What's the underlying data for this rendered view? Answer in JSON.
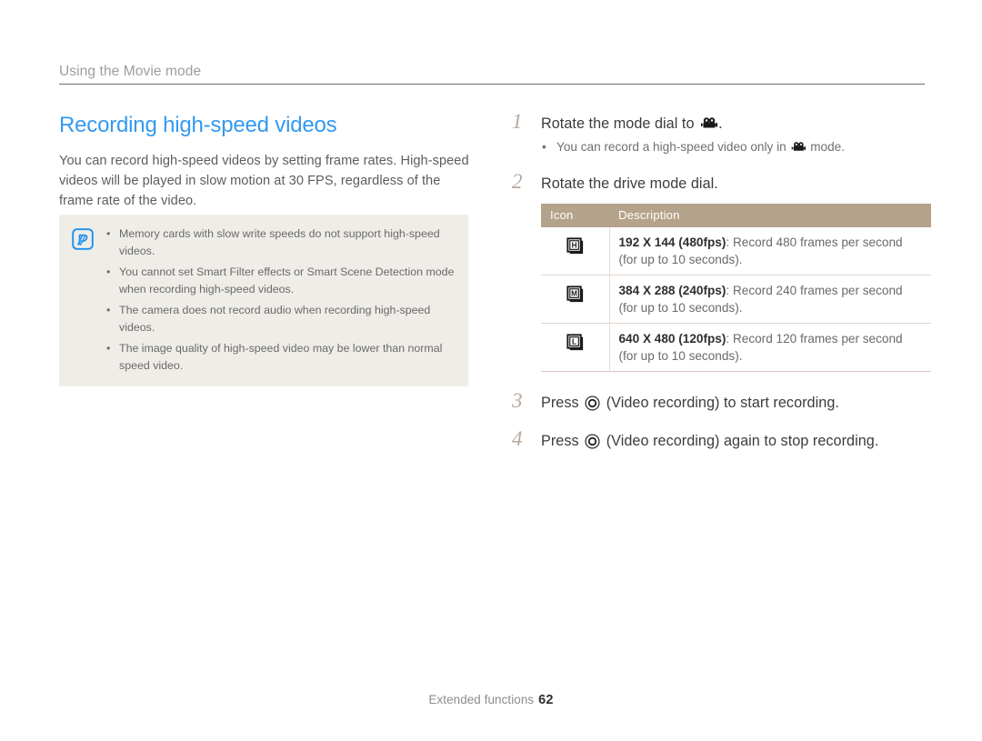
{
  "running_head": "Using the Movie mode",
  "left_column": {
    "title": "Recording high-speed videos",
    "intro": "You can record high-speed videos by setting frame rates. High-speed videos will be played in slow motion at 30 FPS, regardless of the frame rate of the video.",
    "note": {
      "icon": "note-pen-icon",
      "bullets": [
        "Memory cards with slow write speeds do not support high-speed videos.",
        "You cannot set Smart Filter effects or Smart Scene Detection mode when recording high-speed videos.",
        "The camera does not record audio when recording high-speed videos.",
        "The image quality of high-speed video may be lower than normal speed video."
      ],
      "bullet_glyph": "•"
    }
  },
  "right_column": {
    "steps": [
      {
        "number": "1",
        "text_before": "Rotate the mode dial to ",
        "icon": "movie-camera-icon",
        "text_after": ".",
        "sub": {
          "bullet_glyph": "•",
          "text_before": "You can record a high-speed video only in ",
          "icon": "movie-camera-icon",
          "text_after": " mode."
        }
      },
      {
        "number": "2",
        "text_before": "Rotate the drive mode dial.",
        "icon": "",
        "text_after": ""
      },
      {
        "number": "3",
        "text_before": "Press ",
        "icon": "video-recording-button-icon",
        "text_after": " (Video recording) to start recording."
      },
      {
        "number": "4",
        "text_before": "Press ",
        "icon": "video-recording-button-icon",
        "text_after": " (Video recording) again to stop recording."
      }
    ],
    "table": {
      "headers": [
        "Icon",
        "Description"
      ],
      "rows": [
        {
          "icon_letter": "H",
          "icon_name": "high-speed-192x144-icon",
          "bold": "192 X 144 (480fps)",
          "rest": ": Record 480 frames per second (for up to 10 seconds)."
        },
        {
          "icon_letter": "M",
          "icon_name": "high-speed-384x288-icon",
          "bold": "384 X 288 (240fps)",
          "rest": ": Record 240 frames per second (for up to 10 seconds)."
        },
        {
          "icon_letter": "L",
          "icon_name": "high-speed-640x480-icon",
          "bold": "640 X 480 (120fps)",
          "rest": ": Record 120 frames per second (for up to 10 seconds)."
        }
      ]
    }
  },
  "footer": {
    "label": "Extended functions",
    "page_number": "62"
  },
  "colors": {
    "heading_blue": "#3399f0",
    "note_bg": "#efede7",
    "table_header_tan": "#b5a28a",
    "step_number": "#b7a99f",
    "body_text": "#5d5d5d"
  }
}
